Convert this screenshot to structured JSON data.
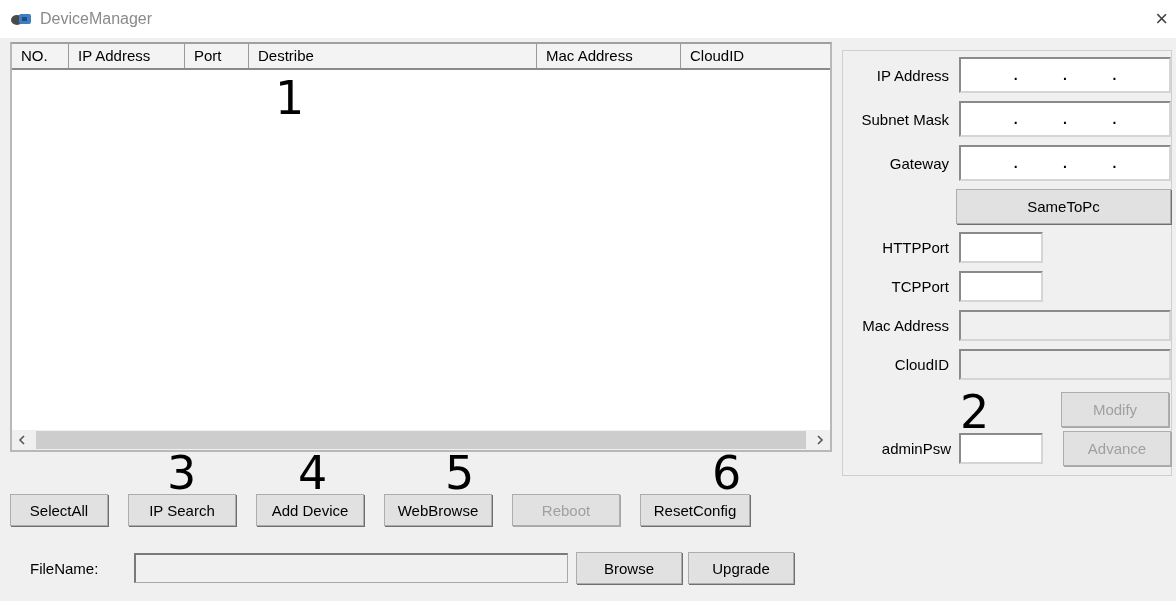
{
  "window": {
    "title": "DeviceManager",
    "close": "×"
  },
  "table": {
    "columns": [
      "NO.",
      "IP Address",
      "Port",
      "Destribe",
      "Mac Address",
      "CloudID"
    ]
  },
  "actions": [
    {
      "label": "SelectAll",
      "disabled": false
    },
    {
      "label": "IP Search",
      "disabled": false
    },
    {
      "label": "Add Device",
      "disabled": false
    },
    {
      "label": "WebBrowse",
      "disabled": false
    },
    {
      "label": "Reboot",
      "disabled": true
    },
    {
      "label": "ResetConfig",
      "disabled": false
    }
  ],
  "file": {
    "label": "FileName:",
    "buttons": [
      {
        "label": "Browse",
        "disabled": false
      },
      {
        "label": "Upgrade",
        "disabled": false
      }
    ]
  },
  "settings": {
    "rows": [
      {
        "kind": "ip",
        "label": "IP Address",
        "separators": [
          ".",
          ".",
          "."
        ]
      },
      {
        "kind": "ip",
        "label": "Subnet Mask",
        "separators": [
          ".",
          ".",
          "."
        ]
      },
      {
        "kind": "ip",
        "label": "Gateway",
        "separators": [
          ".",
          ".",
          "."
        ]
      },
      {
        "kind": "button",
        "label": "SameToPc",
        "disabled": false
      },
      {
        "kind": "short",
        "label": "HTTPPort"
      },
      {
        "kind": "short",
        "label": "TCPPort"
      },
      {
        "kind": "wide",
        "label": "Mac Address",
        "disabled": true
      },
      {
        "kind": "wide",
        "label": "CloudID",
        "disabled": true
      }
    ],
    "modify_button": {
      "label": "Modify",
      "disabled": true
    },
    "password": {
      "label": "adminPsw"
    },
    "advance_button": {
      "label": "Advance",
      "disabled": true
    }
  },
  "annotations": [
    "1",
    "2",
    "3",
    "4",
    "5",
    "6"
  ]
}
